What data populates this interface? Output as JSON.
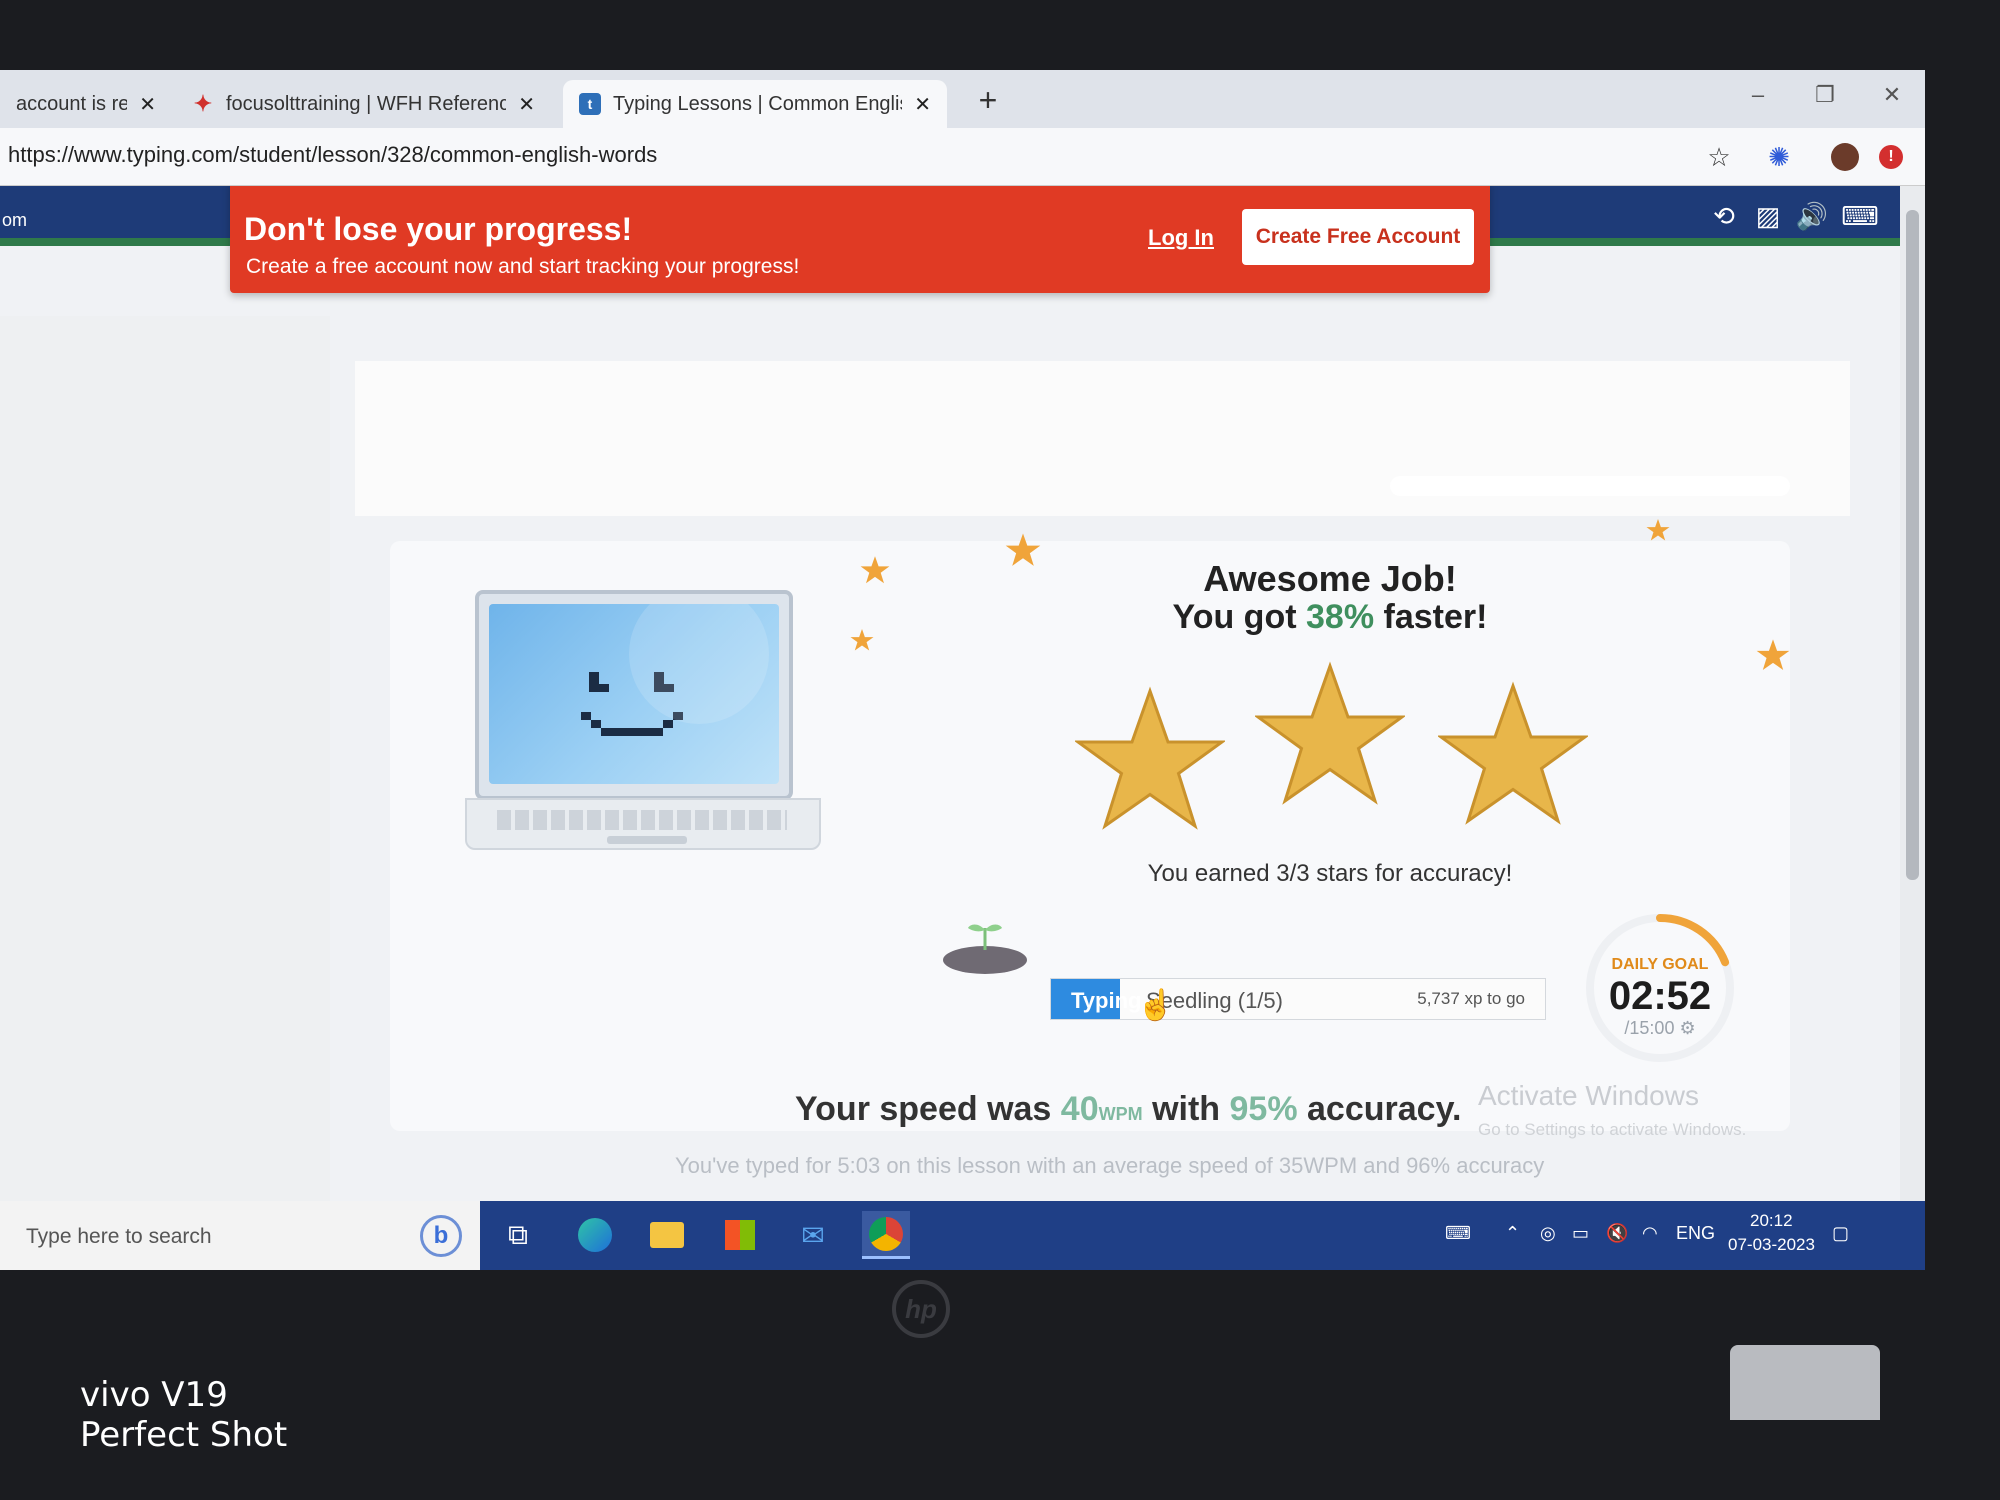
{
  "browser": {
    "tabs": [
      {
        "label": "account is reac",
        "favicon": "generic-icon"
      },
      {
        "label": "focusolttraining | WFH Reference",
        "favicon": "butterfly-icon"
      },
      {
        "label": "Typing Lessons | Common Englisl",
        "favicon": "typing-t-icon",
        "active": true
      }
    ],
    "url": "https://www.typing.com/student/lesson/328/common-english-words"
  },
  "site": {
    "name_fragment": "om"
  },
  "promo": {
    "title": "Don't lose your progress!",
    "subtitle": "Create a free account now and start tracking your progress!",
    "login_label": "Log In",
    "create_label": "Create Free Account"
  },
  "results": {
    "heading": "Awesome Job!",
    "faster_prefix": "You got ",
    "faster_pct": "38%",
    "faster_suffix": " faster!",
    "stars_earned": 3,
    "stars_total": 3,
    "accuracy_message": "You earned 3/3 stars for accuracy!",
    "level_tag": "Typing",
    "level_name": "Seedling (1/5)",
    "xp_to_go": "5,737 xp to go",
    "level_progress_fraction": 0.14,
    "daily_goal_label": "DAILY GOAL",
    "daily_goal_time": "02:52",
    "daily_goal_total": "/15:00 ⚙",
    "daily_goal_fraction": 0.19,
    "speed_prefix": "Your speed was ",
    "speed_value": "40",
    "speed_unit": "WPM",
    "speed_mid": " with ",
    "accuracy_value": "95%",
    "speed_suffix": " accuracy.",
    "average_line": "You've typed for 5:03 on this lesson with an average speed of 35WPM and 96% accuracy"
  },
  "windows": {
    "activate_title": "Activate Windows",
    "activate_sub": "Go to Settings to activate Windows.",
    "search_placeholder": "Type here to search",
    "language": "ENG",
    "time": "20:12",
    "date": "07-03-2023"
  },
  "photo_watermark": {
    "line1": "vivo V19",
    "line2": "Perfect Shot"
  },
  "colors": {
    "promo_red": "#e03a24",
    "header_blue": "#1e3b78",
    "accent_green": "#3f8f5e",
    "level_blue": "#2e8be0",
    "goal_orange": "#e08a1a",
    "star_gold": "#e8b64a"
  }
}
